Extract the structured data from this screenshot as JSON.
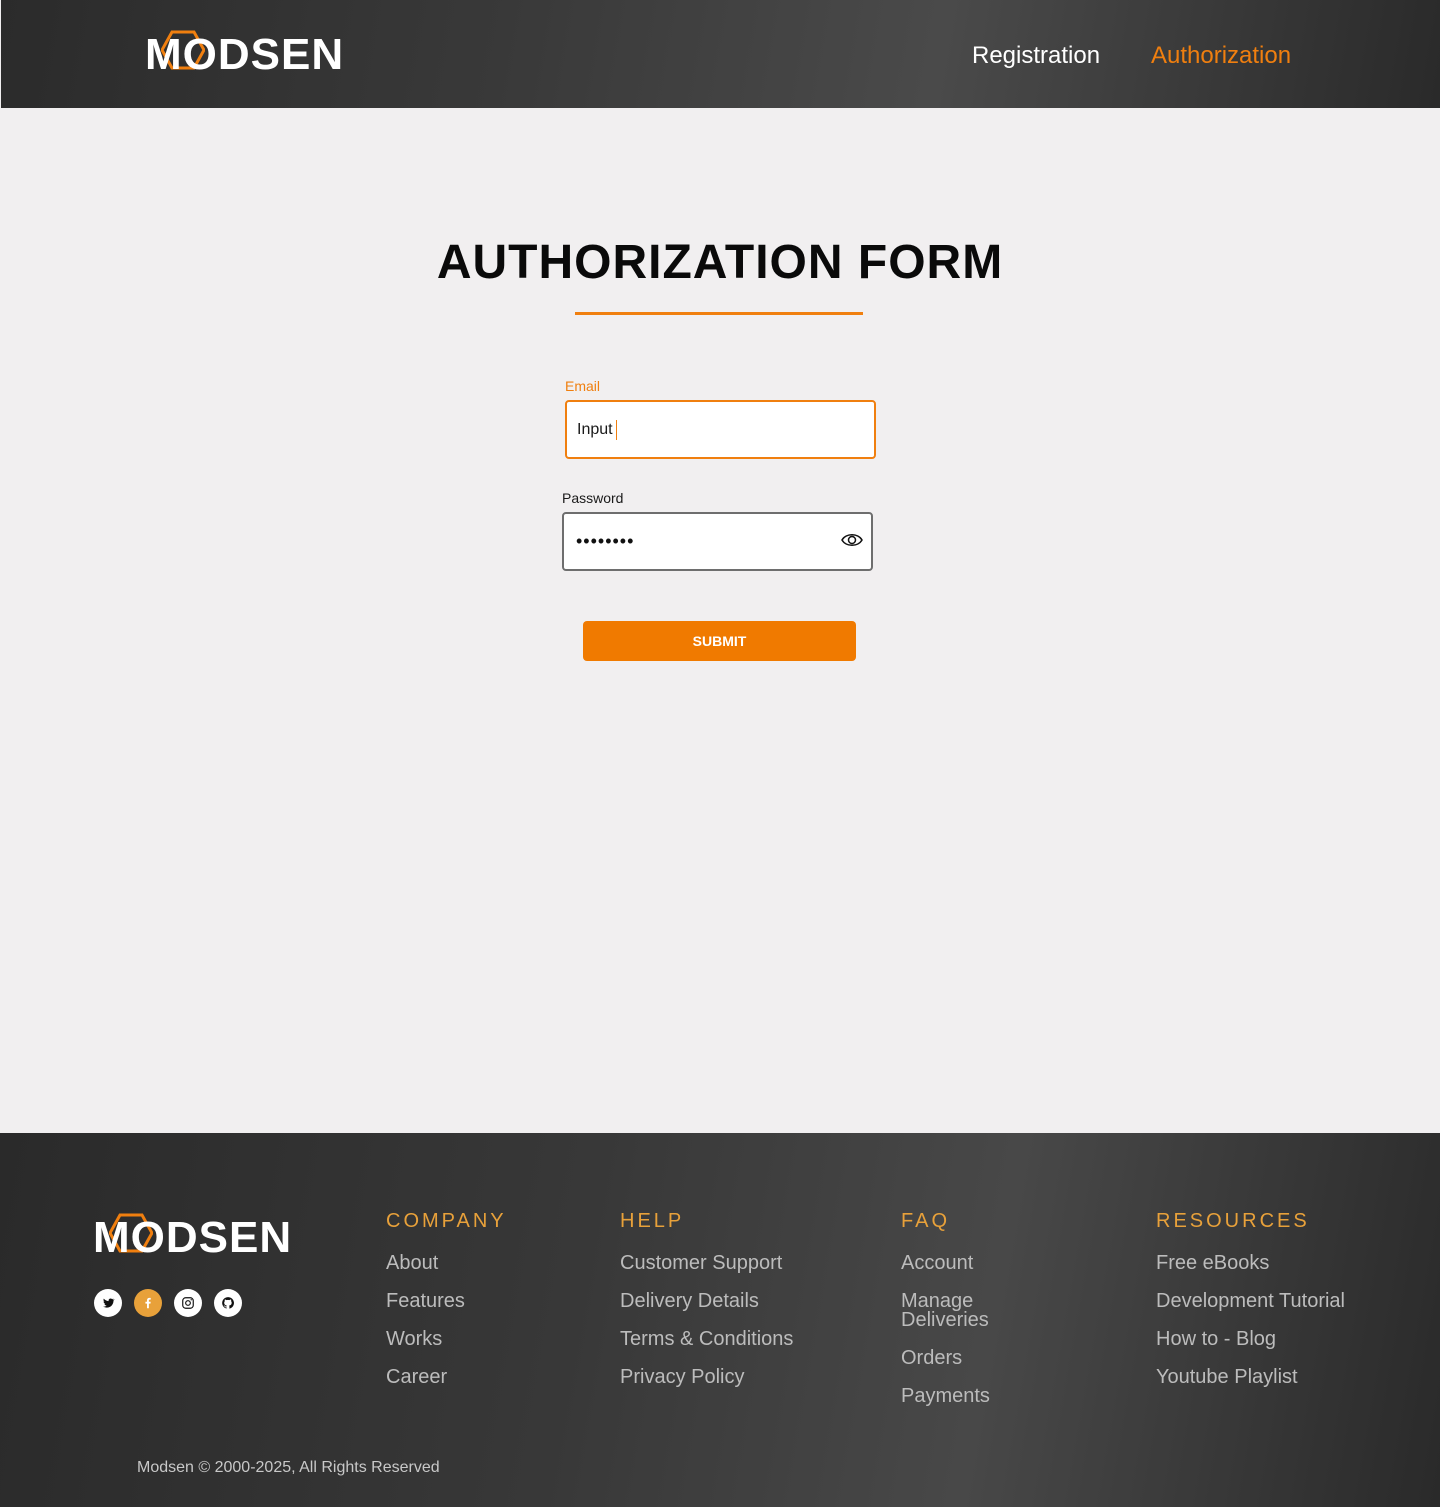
{
  "header": {
    "logo_text": "MODSEN",
    "nav": {
      "registration": "Registration",
      "authorization": "Authorization"
    }
  },
  "form": {
    "title": "AUTHORIZATION FORM",
    "email_label": "Email",
    "email_value": "Input",
    "password_label": "Password",
    "password_value": "••••••••",
    "submit_label": "SUBMIT"
  },
  "footer": {
    "logo_text": "MODSEN",
    "socials": [
      "twitter-icon",
      "facebook-icon",
      "instagram-icon",
      "github-icon"
    ],
    "columns": {
      "company": {
        "heading": "COMPANY",
        "items": [
          "About",
          "Features",
          "Works",
          "Career"
        ]
      },
      "help": {
        "heading": "HELP",
        "items": [
          "Customer Support",
          "Delivery Details",
          "Terms & Conditions",
          "Privacy Policy"
        ]
      },
      "faq": {
        "heading": "FAQ",
        "items": [
          "Account",
          "Manage Deliveries",
          "Orders",
          "Payments"
        ]
      },
      "resources": {
        "heading": "RESOURCES",
        "items": [
          "Free eBooks",
          "Development Tutorial",
          "How to - Blog",
          "Youtube Playlist"
        ]
      }
    },
    "copyright": "Modsen © 2000-2025, All Rights Reserved"
  },
  "colors": {
    "accent": "#f07f0f",
    "footer_heading": "#e8a13a",
    "header_bg": "#3a3a3a",
    "page_bg": "#f1eff0"
  }
}
